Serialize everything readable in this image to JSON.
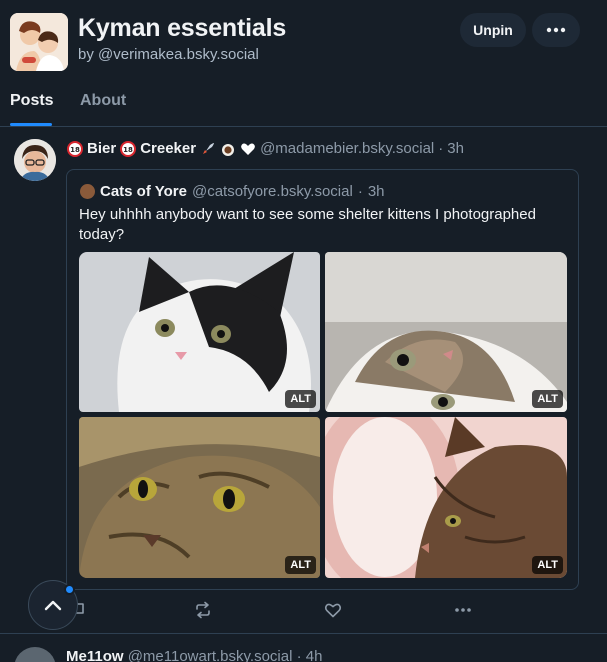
{
  "feed": {
    "title": "Kyman essentials",
    "byline": "by @verimakea.bsky.social",
    "unpin_label": "Unpin"
  },
  "tabs": [
    {
      "label": "Posts",
      "active": true
    },
    {
      "label": "About",
      "active": false
    }
  ],
  "post": {
    "display_name_part1": "Bier",
    "display_name_part2": "Creeker",
    "handle": "@madamebier.bsky.social",
    "time": "3h",
    "quote": {
      "display_name": "Cats of Yore",
      "handle": "@catsofyore.bsky.social",
      "time": "3h",
      "text": "Hey uhhhh anybody want to see some shelter kittens I photographed today?",
      "images": [
        {
          "alt_badge": "ALT"
        },
        {
          "alt_badge": "ALT"
        },
        {
          "alt_badge": "ALT"
        },
        {
          "alt_badge": "ALT"
        }
      ]
    }
  },
  "next_post": {
    "display_name": "Me11ow",
    "handle": "@me11owart.bsky.social",
    "time": "4h"
  },
  "colors": {
    "background": "#161e27",
    "accent": "#208bfe",
    "border": "#2e4052",
    "muted_text": "#8d9aa8"
  }
}
